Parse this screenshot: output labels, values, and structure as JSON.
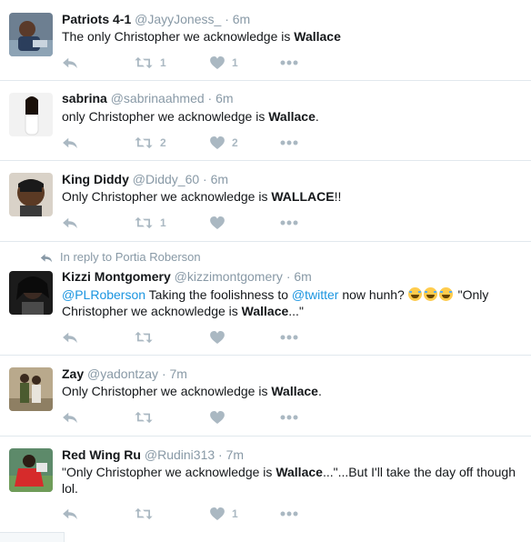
{
  "colors": {
    "link": "#1b95e0",
    "meta": "#8899a6",
    "icon": "#aab8c2",
    "text": "#14171a"
  },
  "tweets": [
    {
      "name": "Patriots 4-1",
      "handle": "@JayyJoness_",
      "sep": "·",
      "time": "6m",
      "text_pre": "The only Christopher we acknowledge is ",
      "text_bold": "Wallace",
      "text_post": "",
      "retweets": "1",
      "likes": "1"
    },
    {
      "name": "sabrina",
      "handle": "@sabrinaahmed",
      "sep": "·",
      "time": "6m",
      "text_pre": "only Christopher we acknowledge is ",
      "text_bold": "Wallace",
      "text_post": ".",
      "retweets": "2",
      "likes": "2"
    },
    {
      "name": "King Diddy",
      "handle": "@Diddy_60",
      "sep": "·",
      "time": "6m",
      "text_pre": "Only Christopher we acknowledge is ",
      "text_bold": "WALLACE",
      "text_post": "!!",
      "retweets": "1",
      "likes": ""
    },
    {
      "reply_context": "In reply to Portia Roberson",
      "name": "Kizzi Montgomery",
      "handle": "@kizzimontgomery",
      "sep": "·",
      "time": "6m",
      "mention1": "@PLRoberson",
      "seg1": " Taking the foolishness to ",
      "mention2": "@twitter",
      "seg2": " now hunh? ",
      "seg3": " \"Only Christopher we acknowledge is ",
      "text_bold": "Wallace",
      "text_post": "...\"",
      "emoji_names": [
        "joy-emoji",
        "joy-emoji",
        "joy-emoji"
      ],
      "retweets": "",
      "likes": ""
    },
    {
      "name": "Zay",
      "handle": "@yadontzay",
      "sep": "·",
      "time": "7m",
      "text_pre": "Only Christopher we acknowledge is ",
      "text_bold": "Wallace",
      "text_post": ".",
      "retweets": "",
      "likes": ""
    },
    {
      "name": "Red Wing Ru",
      "handle": "@Rudini313",
      "sep": "·",
      "time": "7m",
      "text_pre": "\"Only Christopher we acknowledge is ",
      "text_bold": "Wallace",
      "text_post": "...\"...But I'll take the day off though lol.",
      "retweets": "",
      "likes": "1"
    }
  ],
  "icons": {
    "reply": "reply-icon",
    "retweet": "retweet-icon",
    "like": "heart-icon",
    "more": "more-icon"
  }
}
